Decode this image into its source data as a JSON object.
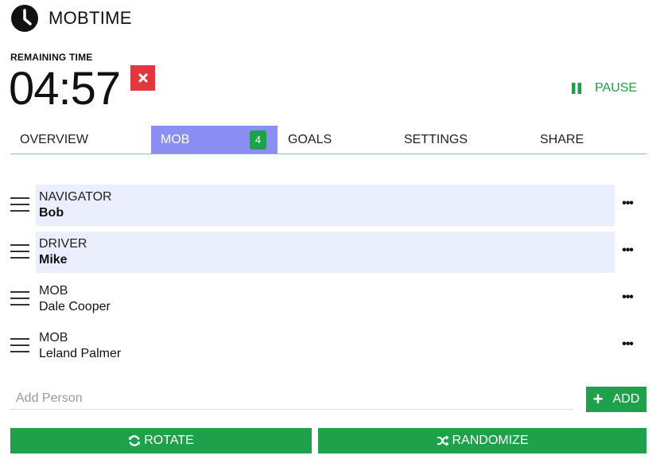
{
  "app": {
    "title": "MOBTIME",
    "icon": "clock-icon"
  },
  "timer": {
    "label": "REMAINING TIME",
    "value": "04:57",
    "clear_icon": "close-icon",
    "pause_label": "PAUSE",
    "pause_icon": "pause-icon"
  },
  "tabs": [
    {
      "label": "OVERVIEW",
      "active": false
    },
    {
      "label": "MOB",
      "active": true,
      "badge": "4"
    },
    {
      "label": "GOALS",
      "active": false
    },
    {
      "label": "SETTINGS",
      "active": false
    },
    {
      "label": "SHARE",
      "active": false
    }
  ],
  "mob": [
    {
      "role": "NAVIGATOR",
      "name": "Bob",
      "highlighted": true
    },
    {
      "role": "DRIVER",
      "name": "Mike",
      "highlighted": true
    },
    {
      "role": "MOB",
      "name": "Dale Cooper",
      "highlighted": false
    },
    {
      "role": "MOB",
      "name": "Leland Palmer",
      "highlighted": false
    }
  ],
  "more_label": "•••",
  "add_person": {
    "placeholder": "Add Person",
    "value": "",
    "button_label": "ADD",
    "button_icon": "plus-icon"
  },
  "actions": {
    "rotate_label": "ROTATE",
    "rotate_icon": "rotate-icon",
    "randomize_label": "RANDOMIZE",
    "randomize_icon": "shuffle-icon"
  },
  "colors": {
    "accent_green": "#1ea14a",
    "active_tab": "#8b8ef2",
    "highlight_row": "#ebeefc",
    "danger": "#e2383d"
  }
}
